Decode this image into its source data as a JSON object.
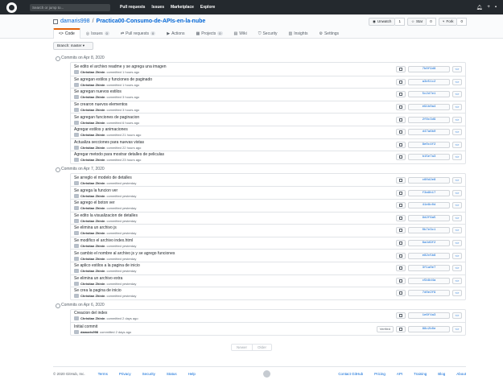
{
  "header": {
    "search_placeholder": "Search or jump to...",
    "nav": [
      "Pull requests",
      "Issues",
      "Marketplace",
      "Explore"
    ],
    "right_icons": [
      "bell-icon",
      "plus-icon",
      "avatar"
    ]
  },
  "repo": {
    "owner": "damaris998",
    "name": "Practica00-Consumo-de-APIs-en-la-nube",
    "watch_label": "Unwatch",
    "watch_count": "1",
    "star_label": "Star",
    "star_count": "0",
    "fork_label": "Fork",
    "fork_count": "0",
    "tabs": [
      {
        "label": "Code",
        "count": ""
      },
      {
        "label": "Issues",
        "count": "0"
      },
      {
        "label": "Pull requests",
        "count": "0"
      },
      {
        "label": "Actions",
        "count": ""
      },
      {
        "label": "Projects",
        "count": "0"
      },
      {
        "label": "Wiki",
        "count": ""
      },
      {
        "label": "Security",
        "count": ""
      },
      {
        "label": "Insights",
        "count": ""
      },
      {
        "label": "Settings",
        "count": ""
      }
    ]
  },
  "branch": {
    "label": "Branch: master ▾"
  },
  "groups": [
    {
      "title": "Commits on Apr 8, 2020",
      "commits": [
        {
          "message": "Se edito el archivo readme y se agrega una imagen",
          "author": "Christian Zhinin",
          "time": "committed 1 hours ago",
          "sha": "7b0f9d8"
        },
        {
          "message": "Se agregan estilos y funciones de paginado",
          "author": "Christian Zhinin",
          "time": "committed 1 hours ago",
          "sha": "a3e51c2"
        },
        {
          "message": "Se agregan nuevos estilos",
          "author": "Christian Zhinin",
          "time": "committed 3 hours ago",
          "sha": "5c2d7e1"
        },
        {
          "message": "Se crearon nuevos elementos",
          "author": "Christian Zhinin",
          "time": "committed 3 hours ago",
          "sha": "e91b0a4"
        },
        {
          "message": "Se agregan funciones de paginacion",
          "author": "Christian Zhinin",
          "time": "committed 6 hours ago",
          "sha": "2f8c3d9"
        },
        {
          "message": "Agregar estilos y animaciones",
          "author": "Christian Zhinin",
          "time": "committed 21 hours ago",
          "sha": "d47a6b0"
        },
        {
          "message": "Actualiza secciones para nuevas vistas",
          "author": "Christian Zhinin",
          "time": "committed 22 hours ago",
          "sha": "8e0c4f2"
        },
        {
          "message": "Agregar metodo para mostrar detalles de peliculas",
          "author": "Christian Zhinin",
          "time": "committed 23 hours ago",
          "sha": "b15e7a3"
        }
      ]
    },
    {
      "title": "Commits on Apr 7, 2020",
      "commits": [
        {
          "message": "Se arreglo el modelo de detalles",
          "author": "Christian Zhinin",
          "time": "committed yesterday",
          "sha": "c60d2e8"
        },
        {
          "message": "Se agrega la funcion ver",
          "author": "Christian Zhinin",
          "time": "committed yesterday",
          "sha": "f3a9b17"
        },
        {
          "message": "Se agrego el boton ver",
          "author": "Christian Zhinin",
          "time": "committed yesterday",
          "sha": "41e8c0d"
        },
        {
          "message": "Se edito la visualizacion de detalles",
          "author": "Christian Zhinin",
          "time": "committed yesterday",
          "sha": "9d2f6a5"
        },
        {
          "message": "Se elimina un archivo js",
          "author": "Christian Zhinin",
          "time": "committed yesterday",
          "sha": "0b7e3c1"
        },
        {
          "message": "Se modifico el archivo index.html",
          "author": "Christian Zhinin",
          "time": "committed yesterday",
          "sha": "6a4d9f2"
        },
        {
          "message": "Se cambio el nombre al archivo js y se agrego funciones",
          "author": "Christian Zhinin",
          "time": "committed yesterday",
          "sha": "e82c5b6"
        },
        {
          "message": "Se aplico estilos a la pagina de inicio",
          "author": "Christian Zhinin",
          "time": "committed yesterday",
          "sha": "3f1a0e7"
        },
        {
          "message": "Se elimina un archivo extra",
          "author": "Christian Zhinin",
          "time": "committed yesterday",
          "sha": "c5b8d4a"
        },
        {
          "message": "Se crea la pagina de inicio",
          "author": "Christian Zhinin",
          "time": "committed yesterday",
          "sha": "7d0e2f9"
        }
      ]
    },
    {
      "title": "Commits on Apr 6, 2020",
      "commits": [
        {
          "message": "Creacion del index",
          "author": "Christian Zhinin",
          "time": "committed 2 days ago",
          "sha": "1e6f4a3",
          "verified": ""
        },
        {
          "message": "Initial commit",
          "author": "damaris998",
          "time": "committed 2 days ago",
          "sha": "88c2b0e",
          "verified": "Verified"
        }
      ]
    }
  ],
  "pagination": {
    "newer": "Newer",
    "older": "Older"
  },
  "footer": {
    "copyright": "© 2020 GitHub, Inc.",
    "links_left": [
      "Terms",
      "Privacy",
      "Security",
      "Status",
      "Help"
    ],
    "links_right": [
      "Contact GitHub",
      "Pricing",
      "API",
      "Training",
      "Blog",
      "About"
    ]
  }
}
